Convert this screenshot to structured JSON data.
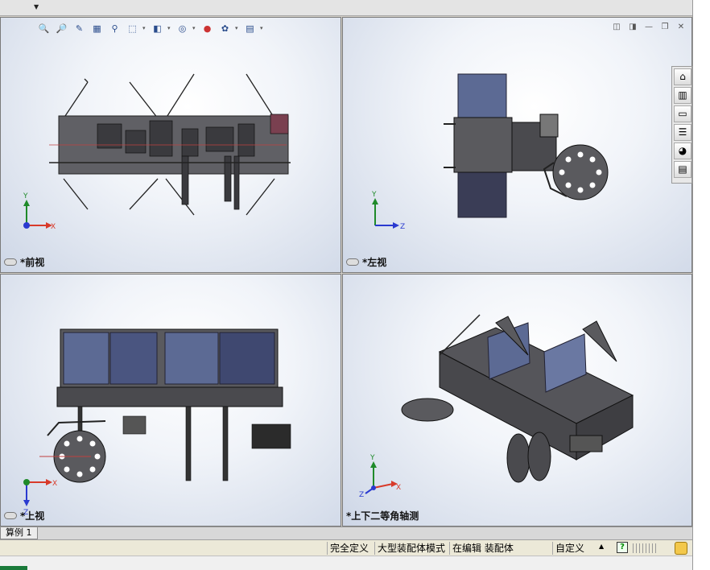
{
  "viewports": [
    {
      "id": "front",
      "label": "*前视"
    },
    {
      "id": "left",
      "label": "*左视"
    },
    {
      "id": "top",
      "label": "*上视"
    },
    {
      "id": "iso",
      "label": "*上下二等角轴测"
    }
  ],
  "axes": {
    "x": "X",
    "y": "Y",
    "z": "Z"
  },
  "hud_icons": [
    "zoom-to-fit-icon",
    "zoom-area-icon",
    "previous-view-icon",
    "section-view-icon",
    "dynamic-annotation-icon",
    "view-orientation-icon",
    "display-style-icon",
    "hide-show-items-icon",
    "edit-appearance-icon",
    "apply-scene-icon",
    "view-settings-icon"
  ],
  "viewport_controls": [
    "tile-horizontal-icon",
    "tile-vertical-icon",
    "minimize-icon",
    "restore-icon",
    "close-icon"
  ],
  "taskpane_icons": [
    "home-icon",
    "design-library-icon",
    "file-explorer-icon",
    "view-palette-icon",
    "appearances-icon",
    "custom-properties-icon"
  ],
  "tab": {
    "label": "算例 1"
  },
  "status": {
    "fully_defined": "完全定义",
    "large_assembly_mode": "大型装配体模式",
    "editing": "在编辑 装配体",
    "units": "自定义",
    "help": "?"
  },
  "colors": {
    "body_metal": "#5a5a5e",
    "hopper_blue": "#5c6a94",
    "axis_x": "#d83a2a",
    "axis_y": "#1f8a2a",
    "axis_z": "#2a3ad0"
  }
}
